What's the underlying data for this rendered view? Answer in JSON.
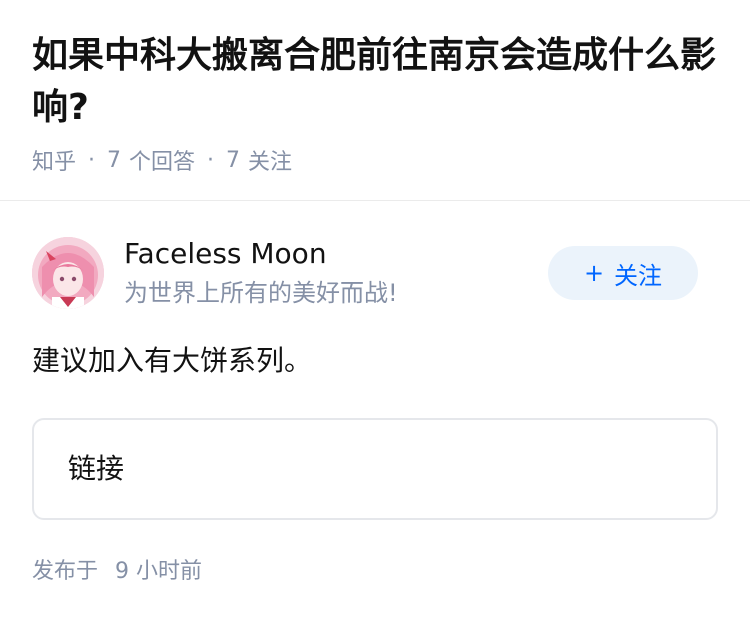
{
  "question": {
    "title": "如果中科大搬离合肥前往南京会造成什么影响?",
    "source": "知乎",
    "separator": "·",
    "answer_count": "7",
    "answer_label": "个回答",
    "follow_count": "7",
    "follow_label": "关注"
  },
  "author": {
    "name": "Faceless Moon",
    "headline": "为世界上所有的美好而战!",
    "follow_button_label": "关注",
    "follow_icon": "plus-icon"
  },
  "answer": {
    "content": "建议加入有大饼系列。",
    "link_card_label": "链接",
    "published_prefix": "发布于",
    "published_time": "9 小时前"
  },
  "colors": {
    "title": "#121212",
    "meta": "#8590a6",
    "follow_bg": "#ebf3fb",
    "follow_text": "#0066ff",
    "card_border": "#e5e7eb"
  }
}
